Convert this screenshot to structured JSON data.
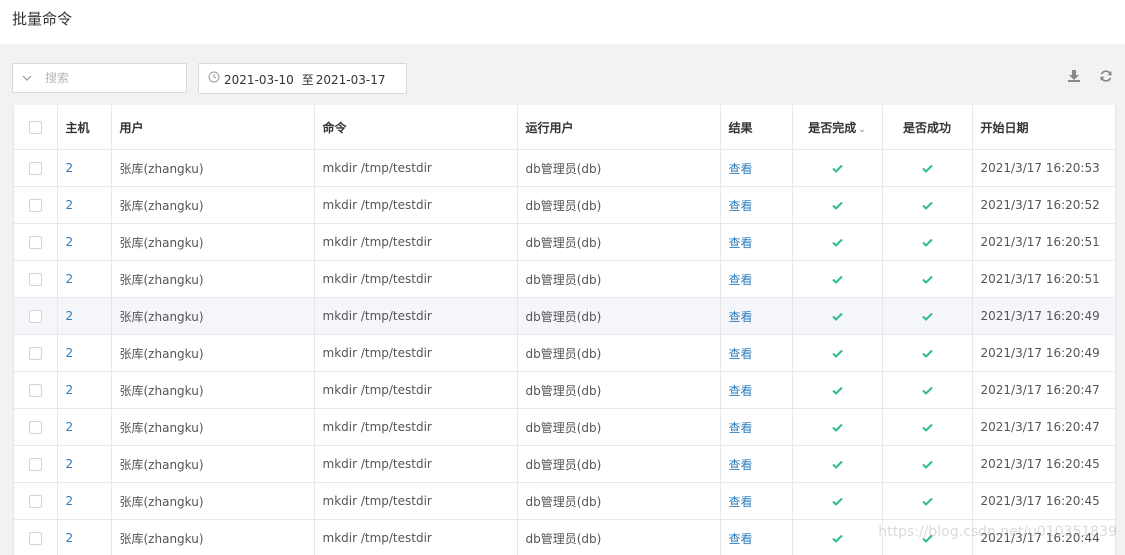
{
  "page": {
    "title": "批量命令"
  },
  "search": {
    "placeholder": "搜索"
  },
  "date_range": {
    "start": "2021-03-10",
    "separator": "至",
    "end": "2021-03-17"
  },
  "toolbar": {
    "download_icon": "download-icon",
    "refresh_icon": "refresh-icon"
  },
  "colors": {
    "link": "#337ab7",
    "check": "#2dbd8a",
    "header_bg": "#ffffff",
    "page_bg": "#f2f2f2"
  },
  "table": {
    "columns": [
      "主机",
      "用户",
      "命令",
      "运行用户",
      "结果",
      "是否完成",
      "是否成功",
      "开始日期"
    ],
    "sorted_column": "是否完成",
    "result_link_label": "查看",
    "rows": [
      {
        "host": "2",
        "user": "张库(zhangku)",
        "command": "mkdir /tmp/testdir",
        "run_user": "db管理员(db)",
        "completed": true,
        "success": true,
        "start": "2021/3/17 16:20:53"
      },
      {
        "host": "2",
        "user": "张库(zhangku)",
        "command": "mkdir /tmp/testdir",
        "run_user": "db管理员(db)",
        "completed": true,
        "success": true,
        "start": "2021/3/17 16:20:52"
      },
      {
        "host": "2",
        "user": "张库(zhangku)",
        "command": "mkdir /tmp/testdir",
        "run_user": "db管理员(db)",
        "completed": true,
        "success": true,
        "start": "2021/3/17 16:20:51"
      },
      {
        "host": "2",
        "user": "张库(zhangku)",
        "command": "mkdir /tmp/testdir",
        "run_user": "db管理员(db)",
        "completed": true,
        "success": true,
        "start": "2021/3/17 16:20:51"
      },
      {
        "host": "2",
        "user": "张库(zhangku)",
        "command": "mkdir /tmp/testdir",
        "run_user": "db管理员(db)",
        "completed": true,
        "success": true,
        "start": "2021/3/17 16:20:49"
      },
      {
        "host": "2",
        "user": "张库(zhangku)",
        "command": "mkdir /tmp/testdir",
        "run_user": "db管理员(db)",
        "completed": true,
        "success": true,
        "start": "2021/3/17 16:20:49"
      },
      {
        "host": "2",
        "user": "张库(zhangku)",
        "command": "mkdir /tmp/testdir",
        "run_user": "db管理员(db)",
        "completed": true,
        "success": true,
        "start": "2021/3/17 16:20:47"
      },
      {
        "host": "2",
        "user": "张库(zhangku)",
        "command": "mkdir /tmp/testdir",
        "run_user": "db管理员(db)",
        "completed": true,
        "success": true,
        "start": "2021/3/17 16:20:47"
      },
      {
        "host": "2",
        "user": "张库(zhangku)",
        "command": "mkdir /tmp/testdir",
        "run_user": "db管理员(db)",
        "completed": true,
        "success": true,
        "start": "2021/3/17 16:20:45"
      },
      {
        "host": "2",
        "user": "张库(zhangku)",
        "command": "mkdir /tmp/testdir",
        "run_user": "db管理员(db)",
        "completed": true,
        "success": true,
        "start": "2021/3/17 16:20:45"
      },
      {
        "host": "2",
        "user": "张库(zhangku)",
        "command": "mkdir /tmp/testdir",
        "run_user": "db管理员(db)",
        "completed": true,
        "success": true,
        "start": "2021/3/17 16:20:44"
      }
    ]
  },
  "watermark": "https://blog.csdn.net/u010351839"
}
